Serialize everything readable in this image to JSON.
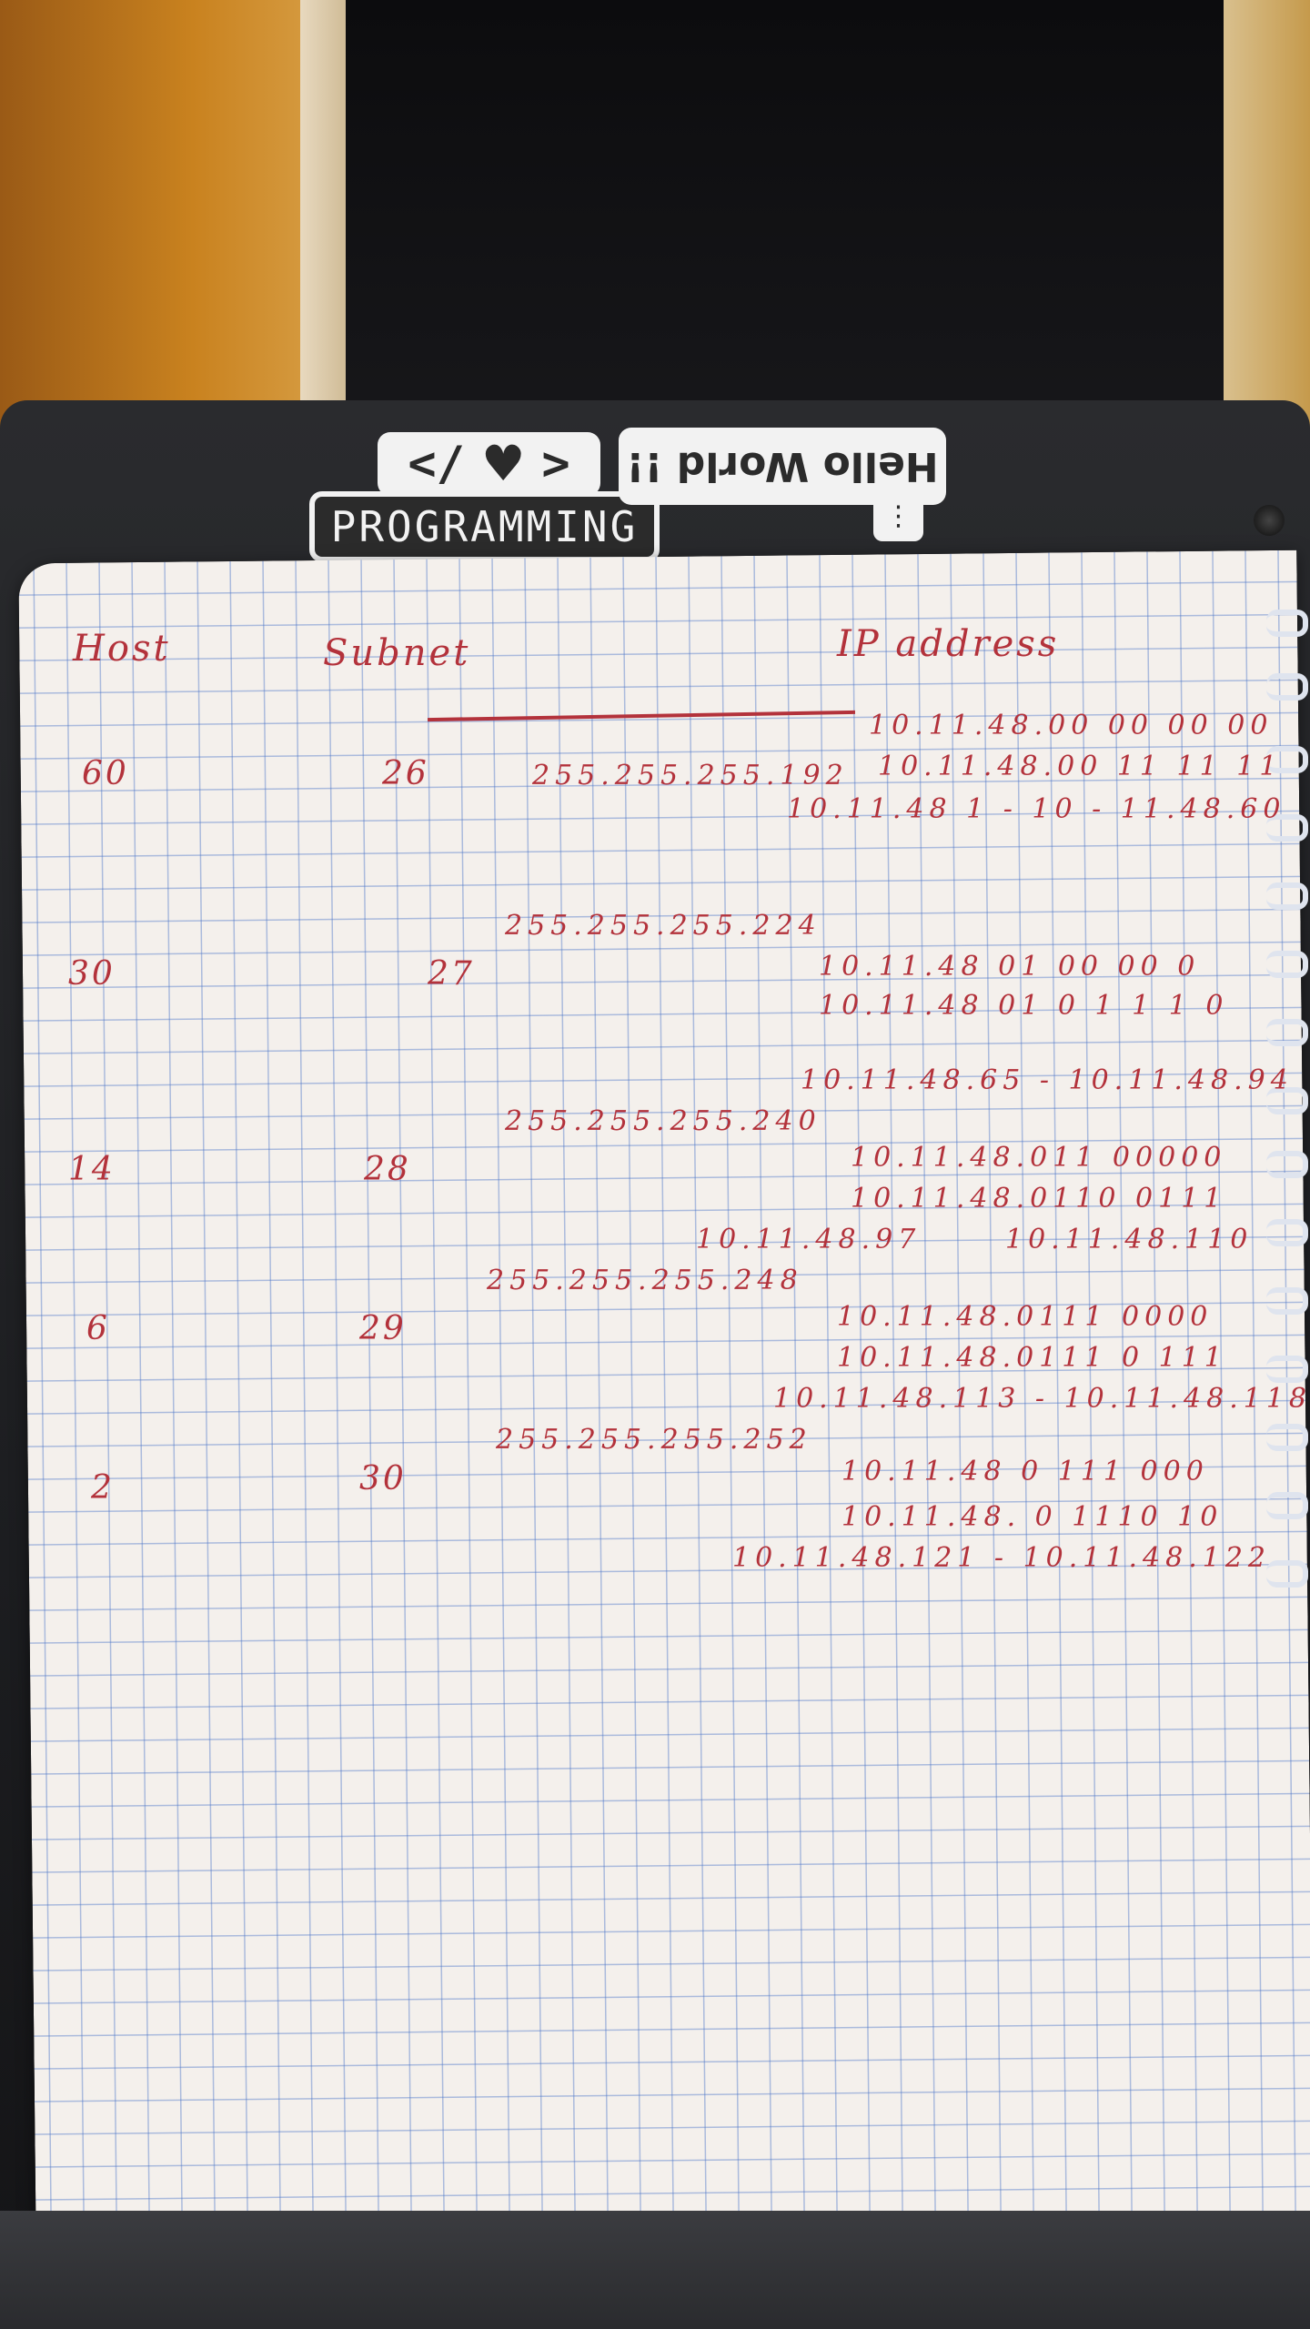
{
  "stickers": {
    "code_brackets": [
      "</",
      ">"
    ],
    "programming": "PROGRAMMING",
    "hello": "Hello World !!"
  },
  "headers": {
    "host": "Host",
    "subnet": "Subnet",
    "ip": "IP address"
  },
  "rows": [
    {
      "host": "60",
      "prefix": "26",
      "mask": "255.255.255.192",
      "ip_lines": [
        "10.11.48.00 00 00 00",
        "10.11.48.00 11 11 11",
        "10.11.48  1 - 10 - 11.48.60"
      ]
    },
    {
      "host": "30",
      "prefix": "27",
      "mask": "255.255.255.224",
      "ip_lines": [
        "10.11.48  01 00 00 0",
        "10.11.48  01 0 1 1 1 0",
        "10.11.48.65 - 10.11.48.94"
      ]
    },
    {
      "host": "14",
      "prefix": "28",
      "mask": "255.255.255.240",
      "ip_lines": [
        "10.11.48.011 00000",
        "10.11.48.0110 0111",
        "10.11.48.97",
        "10.11.48.110"
      ]
    },
    {
      "host": "6",
      "prefix": "29",
      "mask": "255.255.255.248",
      "ip_lines": [
        "10.11.48.0111 0000",
        "10.11.48.0111 0 111",
        "10.11.48.113 - 10.11.48.118"
      ]
    },
    {
      "host": "2",
      "prefix": "30",
      "mask": "255.255.255.252",
      "ip_lines": [
        "10.11.48  0 111 000",
        "10.11.48. 0 1110 10",
        "10.11.48.121 - 10.11.48.122"
      ]
    }
  ]
}
